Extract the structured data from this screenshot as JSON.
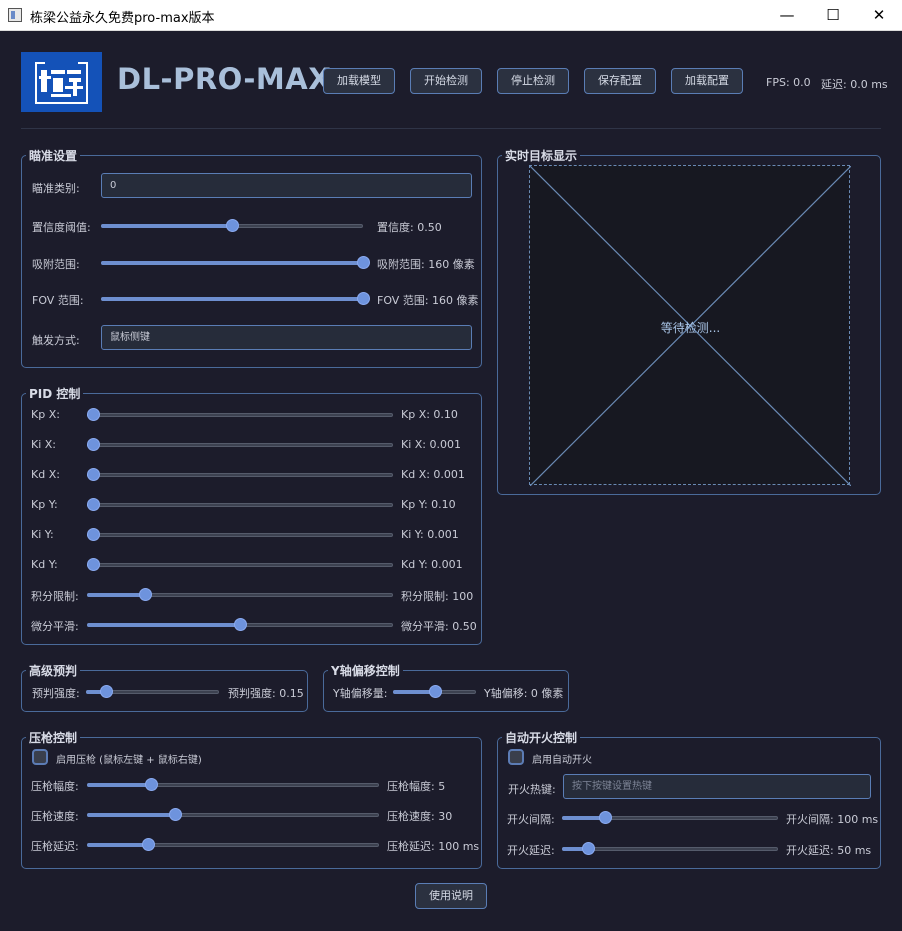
{
  "window": {
    "title": "栋梁公益永久免费pro-max版本",
    "minimize": "—",
    "maximize": "☐",
    "close": "✕"
  },
  "header": {
    "logo_text": "DL-PRO-MAX",
    "buttons": {
      "load_model": "加载模型",
      "start_detect": "开始检测",
      "stop_detect": "停止检测",
      "save_config": "保存配置",
      "load_config": "加载配置"
    },
    "fps": "FPS: 0.0",
    "latency": "延迟: 0.0 ms"
  },
  "aim": {
    "title": "瞄准设置",
    "target_class_label": "瞄准类别:",
    "target_class_value": "0",
    "confidence_label": "置信度阈值:",
    "confidence_value": "置信度: 0.50",
    "confidence_level": 0.5,
    "snap_label": "吸附范围:",
    "snap_value": "吸附范围: 160 像素",
    "snap_level": 1.0,
    "fov_label": "FOV 范围:",
    "fov_value": "FOV 范围: 160 像素",
    "fov_level": 1.0,
    "trigger_label": "触发方式:",
    "trigger_value": "鼠标侧键"
  },
  "display": {
    "title": "实时目标显示",
    "status": "等待检测..."
  },
  "pid": {
    "title": "PID 控制",
    "rows": [
      {
        "label": "Kp X:",
        "value": "Kp X: 0.10",
        "level": 0.02
      },
      {
        "label": "Ki X:",
        "value": "Ki X: 0.001",
        "level": 0.02
      },
      {
        "label": "Kd X:",
        "value": "Kd X: 0.001",
        "level": 0.02
      },
      {
        "label": "Kp Y:",
        "value": "Kp Y: 0.10",
        "level": 0.02
      },
      {
        "label": "Ki Y:",
        "value": "Ki Y: 0.001",
        "level": 0.02
      },
      {
        "label": "Kd Y:",
        "value": "Kd Y: 0.001",
        "level": 0.02
      },
      {
        "label": "积分限制:",
        "value": "积分限制: 100",
        "level": 0.19
      },
      {
        "label": "微分平滑:",
        "value": "微分平滑: 0.50",
        "level": 0.5
      }
    ]
  },
  "prediction": {
    "title": "高级预判",
    "label": "预判强度:",
    "value": "预判强度: 0.15",
    "level": 0.15
  },
  "y_offset": {
    "title": "Y轴偏移控制",
    "label": "Y轴偏移量:",
    "value": "Y轴偏移: 0 像素",
    "level": 0.5
  },
  "recoil": {
    "title": "压枪控制",
    "enable_label": "启用压枪 (鼠标左键 + 鼠标右键)",
    "rows": [
      {
        "label": "压枪幅度:",
        "value": "压枪幅度: 5",
        "level": 0.22
      },
      {
        "label": "压枪速度:",
        "value": "压枪速度: 30",
        "level": 0.3
      },
      {
        "label": "压枪延迟:",
        "value": "压枪延迟: 100 ms",
        "level": 0.21
      }
    ]
  },
  "autofire": {
    "title": "自动开火控制",
    "enable_label": "启用自动开火",
    "hotkey_label": "开火热键:",
    "hotkey_placeholder": "按下按键设置热键",
    "rows": [
      {
        "label": "开火间隔:",
        "value": "开火间隔: 100 ms",
        "level": 0.2
      },
      {
        "label": "开火延迟:",
        "value": "开火延迟: 50 ms",
        "level": 0.12
      }
    ]
  },
  "help_button": "使用说明",
  "colors": {
    "background": "#1c1c2b",
    "accent": "#6e93dd",
    "border": "#4a6a9a",
    "logo_bg": "#1452b8"
  }
}
